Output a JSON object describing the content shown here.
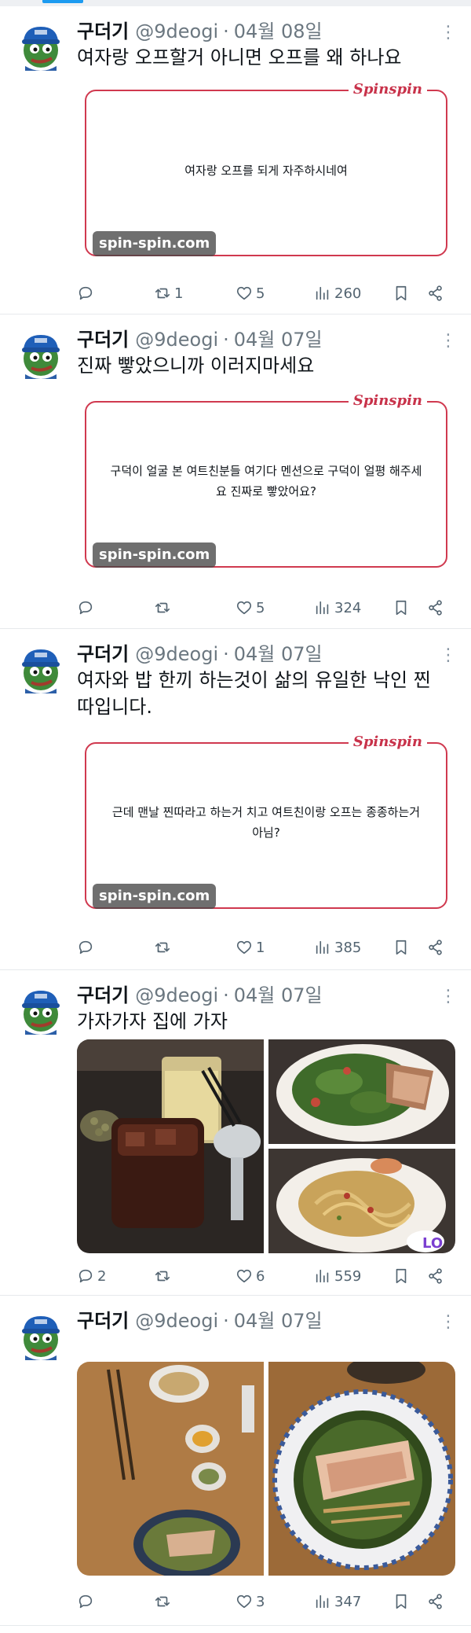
{
  "tweets": [
    {
      "name": "구더기",
      "handle": "@9deogi",
      "sep": "·",
      "date": "04월 08일",
      "text": "여자랑 오프할거 아니면 오프를 왜 하나요",
      "card": {
        "brand": "Spinspin",
        "text": "여자랑 오프를 되게 자주하시네여",
        "site": "spin-spin.com"
      },
      "stats": {
        "replies": "",
        "retweets": "1",
        "likes": "5",
        "views": "260"
      }
    },
    {
      "name": "구더기",
      "handle": "@9deogi",
      "sep": "·",
      "date": "04월 07일",
      "text": "진짜 빻았으니까 이러지마세요",
      "card": {
        "brand": "Spinspin",
        "text": "구덕이 얼굴 본 여트친분들 여기다 멘션으로 구덕이 얼평 해주세요 진짜로 빻았어요?",
        "site": "spin-spin.com"
      },
      "stats": {
        "replies": "",
        "retweets": "",
        "likes": "5",
        "views": "324"
      }
    },
    {
      "name": "구더기",
      "handle": "@9deogi",
      "sep": "·",
      "date": "04월 07일",
      "text": "여자와 밥 한끼 하는것이 삶의 유일한 낙인 찐따입니다.",
      "card": {
        "brand": "Spinspin",
        "text": "근데 맨날 찐따라고 하는거 치고 여트친이랑 오프는 종종하는거 아님?",
        "site": "spin-spin.com"
      },
      "stats": {
        "replies": "",
        "retweets": "",
        "likes": "1",
        "views": "385"
      }
    },
    {
      "name": "구더기",
      "handle": "@9deogi",
      "sep": "·",
      "date": "04월 07일",
      "text": "가자가자 집에 가자",
      "stats": {
        "replies": "2",
        "retweets": "",
        "likes": "6",
        "views": "559"
      }
    },
    {
      "name": "구더기",
      "handle": "@9deogi",
      "sep": "·",
      "date": "04월 07일",
      "text": "",
      "stats": {
        "replies": "",
        "retweets": "",
        "likes": "3",
        "views": "347"
      }
    }
  ],
  "icons": {
    "reply": "reply-icon",
    "retweet": "retweet-icon",
    "like": "like-icon",
    "views": "views-icon",
    "bookmark": "bookmark-icon",
    "share": "share-icon",
    "more": "more-icon"
  },
  "colors": {
    "card_border": "#d0394f",
    "secondary_text": "#536471",
    "accent": "#1d9bf0"
  }
}
